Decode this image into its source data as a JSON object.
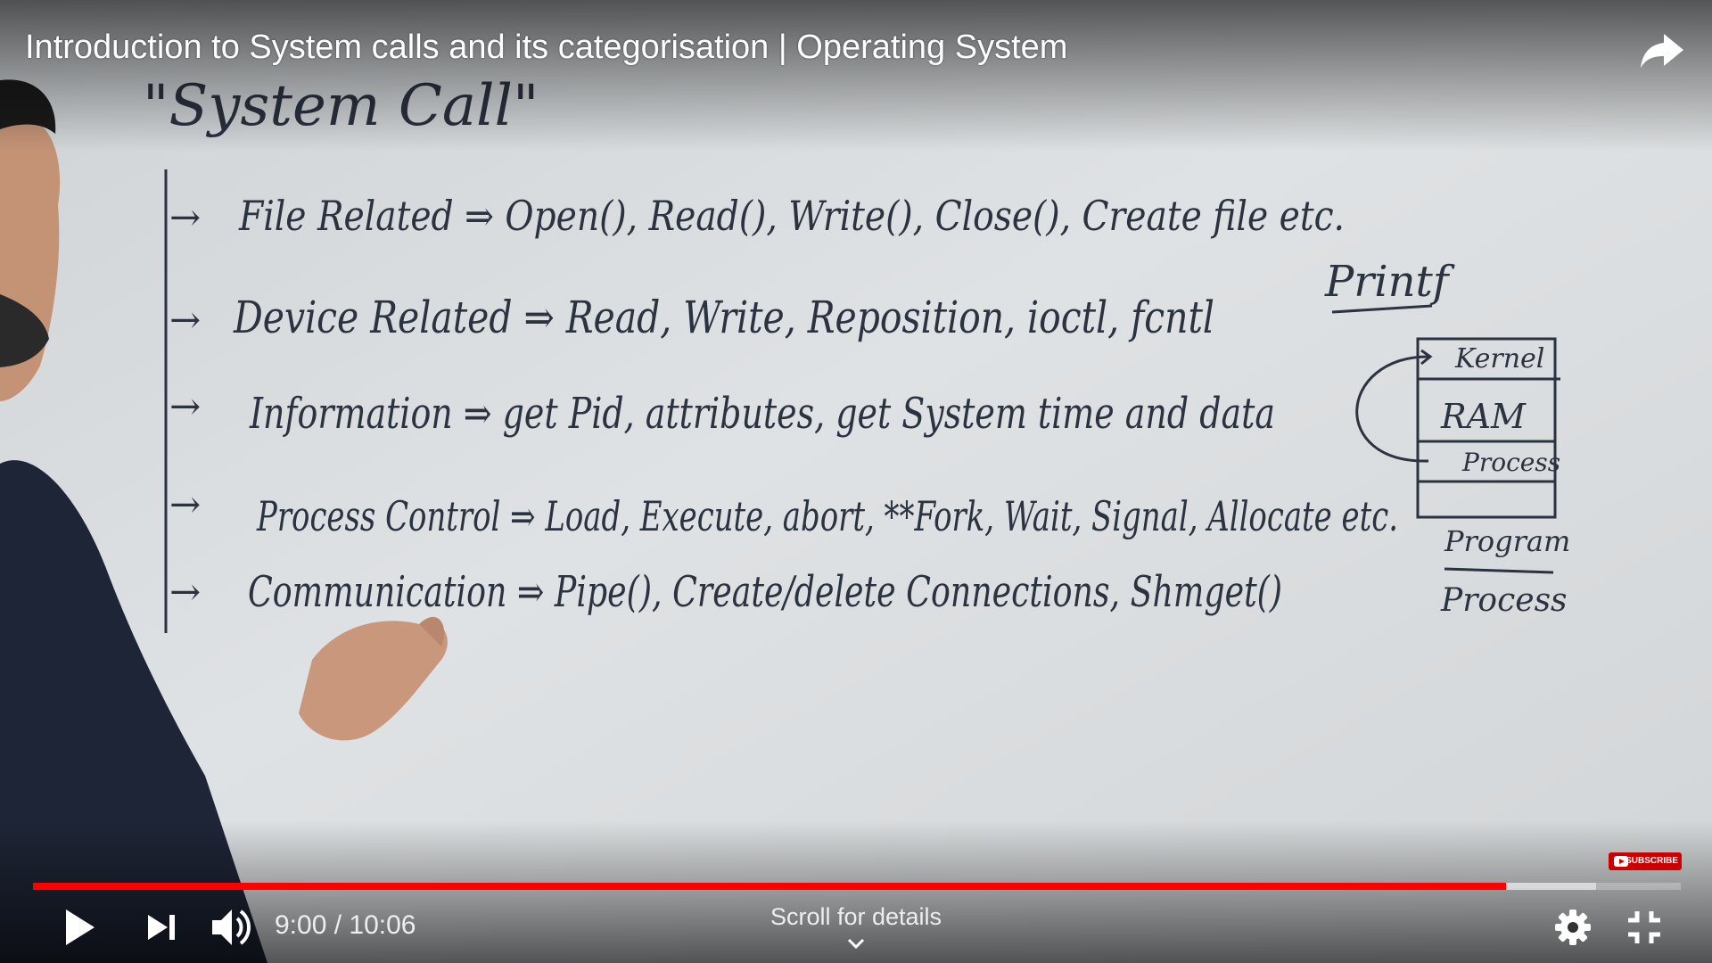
{
  "video": {
    "title": "Introduction to System calls and its categorisation | Operating System"
  },
  "whiteboard": {
    "heading": "\"System Call\"",
    "lines": [
      "File Related ⇒ Open(), Read(), Write(), Close(), Create file etc.",
      "Device Related ⇒ Read, Write, Reposition, ioctl, fcntl",
      "Information ⇒ get Pid, attributes, get System time and data",
      "Process Control ⇒ Load, Execute, abort, **Fork, Wait, Signal, Allocate etc.",
      "Communication ⇒ Pipe(), Create/delete Connections, Shmget()"
    ],
    "side_note": "Printf",
    "memory_blocks": [
      "Kernel",
      "RAM",
      "Process"
    ],
    "fraction_top": "Program",
    "fraction_bottom": "Process"
  },
  "controls": {
    "current_time": "9:00",
    "separator": " / ",
    "duration": "10:06",
    "time_display": "9:00 / 10:06",
    "played_fraction": 0.894,
    "buffered_fraction": 0.9485,
    "scroll_hint": "Scroll for details",
    "subscribe_label": "SUBSCRIBE"
  },
  "icons": {
    "play": "play-icon",
    "next": "next-icon",
    "volume": "volume-icon",
    "settings": "gear-icon",
    "exit_fullscreen": "exit-fullscreen-icon",
    "share": "share-icon"
  },
  "colors": {
    "progress_played": "#ff0000",
    "ink": "#2b3240",
    "board": "#d9dde0"
  }
}
